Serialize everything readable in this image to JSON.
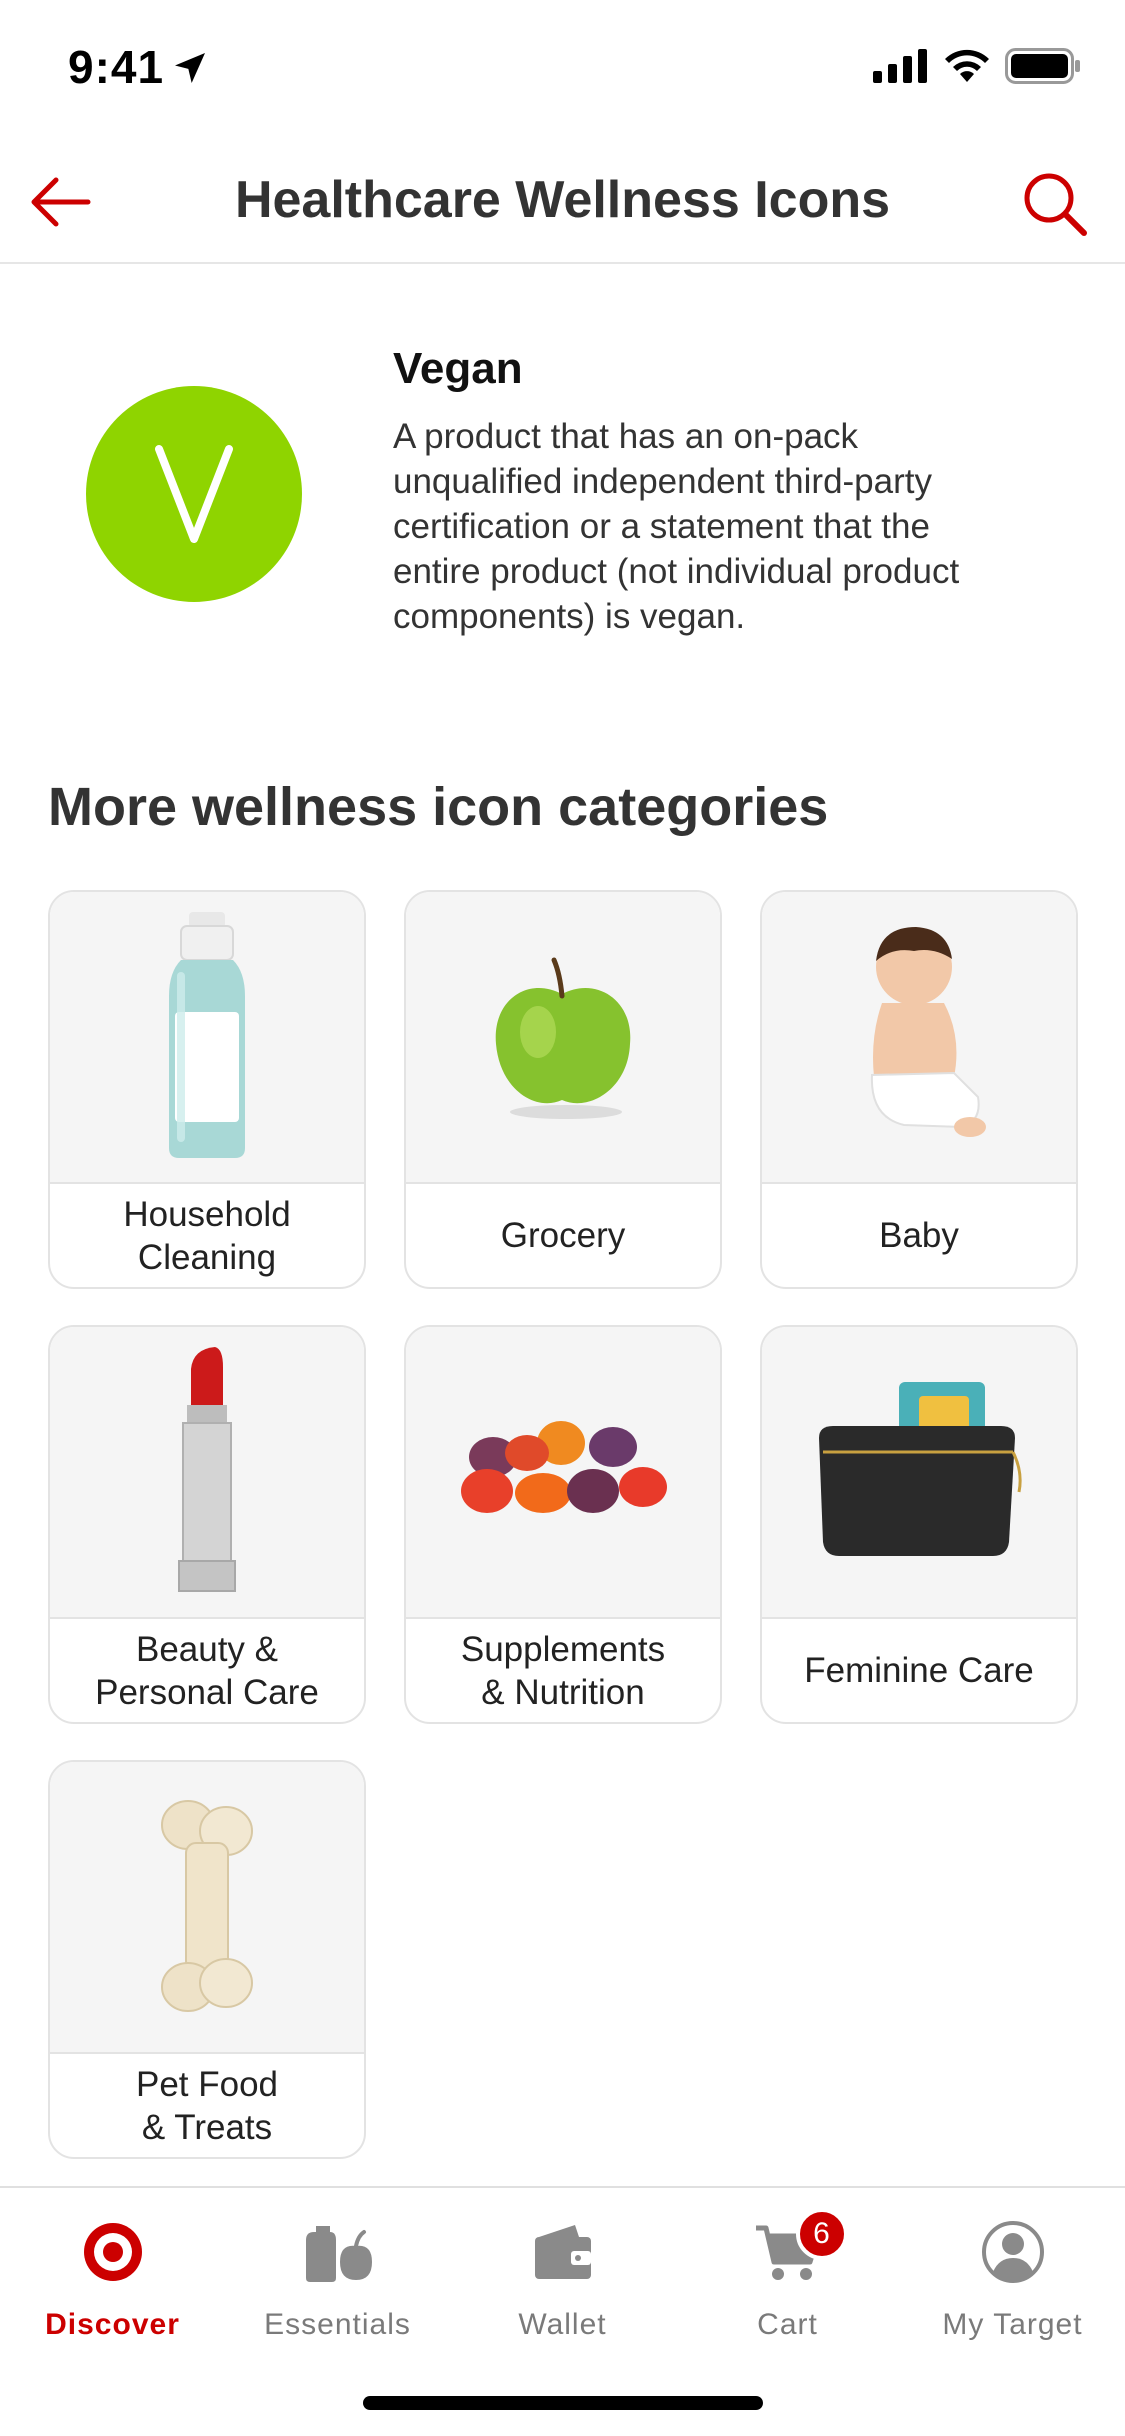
{
  "status_bar": {
    "time": "9:41",
    "icons": [
      "location-arrow-icon",
      "signal-icon",
      "wifi-icon",
      "battery-icon"
    ]
  },
  "header": {
    "title": "Healthcare Wellness Icons",
    "back_icon": "arrow-left-icon",
    "search_icon": "search-icon",
    "accent_color": "#cc0000"
  },
  "vegan": {
    "badge_letter": "V",
    "badge_color": "#8fd400",
    "title": "Vegan",
    "description": "A product that has an on-pack unqualified independent third-party certification or a statement that the entire product (not individual product components) is vegan."
  },
  "categories": {
    "title": "More wellness icon categories",
    "items": [
      {
        "label": "Household\nCleaning",
        "icon": "cleaning-bottle-icon"
      },
      {
        "label": "Grocery",
        "icon": "apple-icon"
      },
      {
        "label": "Baby",
        "icon": "baby-icon"
      },
      {
        "label": "Beauty &\nPersonal Care",
        "icon": "lipstick-icon"
      },
      {
        "label": "Supplements\n& Nutrition",
        "icon": "gummies-icon"
      },
      {
        "label": "Feminine Care",
        "icon": "pouch-icon"
      },
      {
        "label": "Pet Food\n& Treats",
        "icon": "dog-bone-icon"
      }
    ]
  },
  "tabs": [
    {
      "label": "Discover",
      "icon": "target-bullseye-icon",
      "active": true
    },
    {
      "label": "Essentials",
      "icon": "essentials-icon",
      "active": false
    },
    {
      "label": "Wallet",
      "icon": "wallet-icon",
      "active": false
    },
    {
      "label": "Cart",
      "icon": "cart-icon",
      "active": false,
      "badge": "6"
    },
    {
      "label": "My Target",
      "icon": "profile-icon",
      "active": false
    }
  ]
}
